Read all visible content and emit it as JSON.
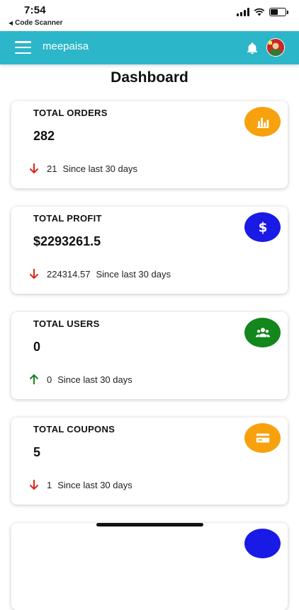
{
  "status_bar": {
    "time": "7:54",
    "back_label": "Code Scanner",
    "battery_level": 0.55
  },
  "app_bar": {
    "title": "meepaisa"
  },
  "page": {
    "title": "Dashboard"
  },
  "cards": [
    {
      "title": "TOTAL ORDERS",
      "value": "282",
      "delta": "21",
      "period": "Since last 30 days",
      "trend": "down",
      "icon": "bar-chart-icon",
      "icon_color": "#f7a10d"
    },
    {
      "title": "TOTAL PROFIT",
      "value": "$2293261.5",
      "delta": "224314.57",
      "period": "Since last 30 days",
      "trend": "down",
      "icon": "dollar-icon",
      "icon_color": "#1a1ae6"
    },
    {
      "title": "TOTAL USERS",
      "value": "0",
      "delta": "0",
      "period": "Since last 30 days",
      "trend": "up",
      "icon": "users-icon",
      "icon_color": "#13861c"
    },
    {
      "title": "TOTAL COUPONS",
      "value": "5",
      "delta": "1",
      "period": "Since last 30 days",
      "trend": "down",
      "icon": "card-icon",
      "icon_color": "#f7a10d"
    }
  ],
  "colors": {
    "app_bar": "#2bb6c9",
    "trend_down": "#e0241b",
    "trend_up": "#13861c"
  }
}
